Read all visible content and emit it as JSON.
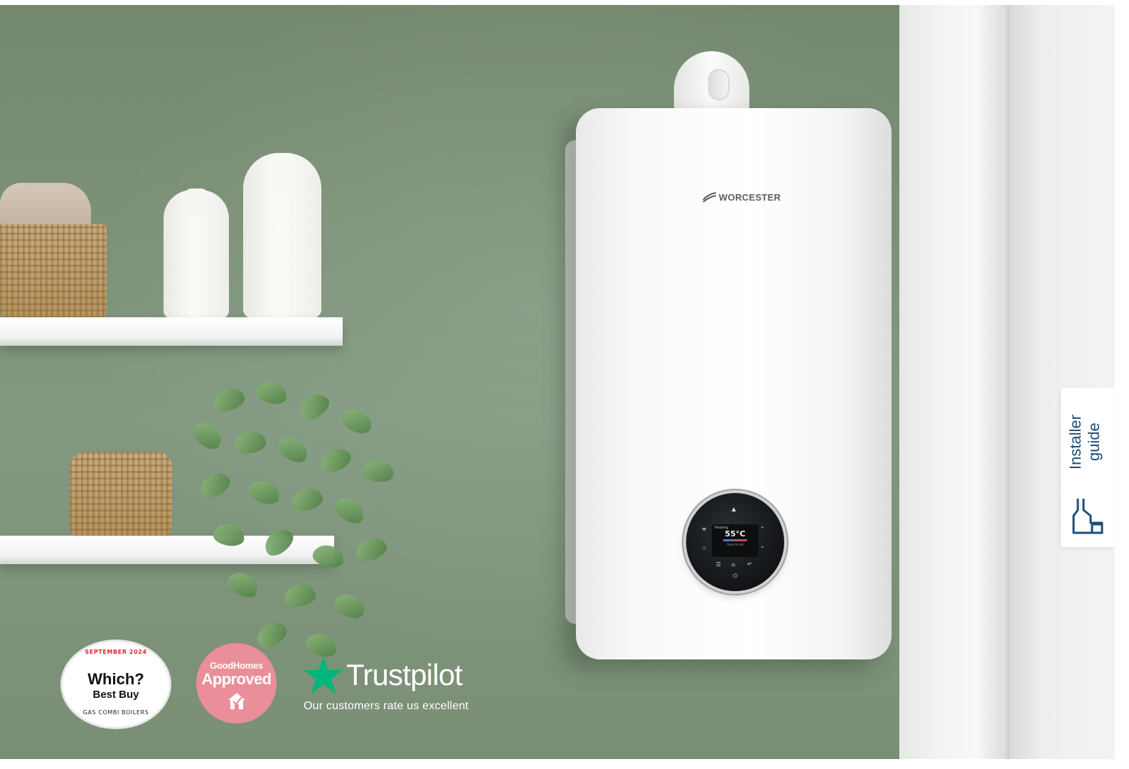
{
  "boiler": {
    "brand": "WORCESTER",
    "display": {
      "mode": "Heating",
      "temperature": "55°C",
      "hint": "Press to set"
    }
  },
  "badges": {
    "which": {
      "top_text": "SEPTEMBER 2024",
      "title": "Which?",
      "subtitle": "Best Buy",
      "bottom_text": "GAS COMBI BOILERS"
    },
    "goodhomes": {
      "title": "GoodHomes",
      "subtitle": "Approved"
    },
    "trustpilot": {
      "name": "Trustpilot",
      "tagline": "Our customers rate us excellent"
    }
  },
  "installer_guide": {
    "label_line1": "Installer",
    "label_line2": "guide",
    "icon": "installer-wrench-icon"
  },
  "colors": {
    "trustpilot_green": "#00b67a",
    "installer_blue": "#1b4e7a",
    "goodhomes_pink": "#ea8e99",
    "which_red": "#e3262f"
  }
}
